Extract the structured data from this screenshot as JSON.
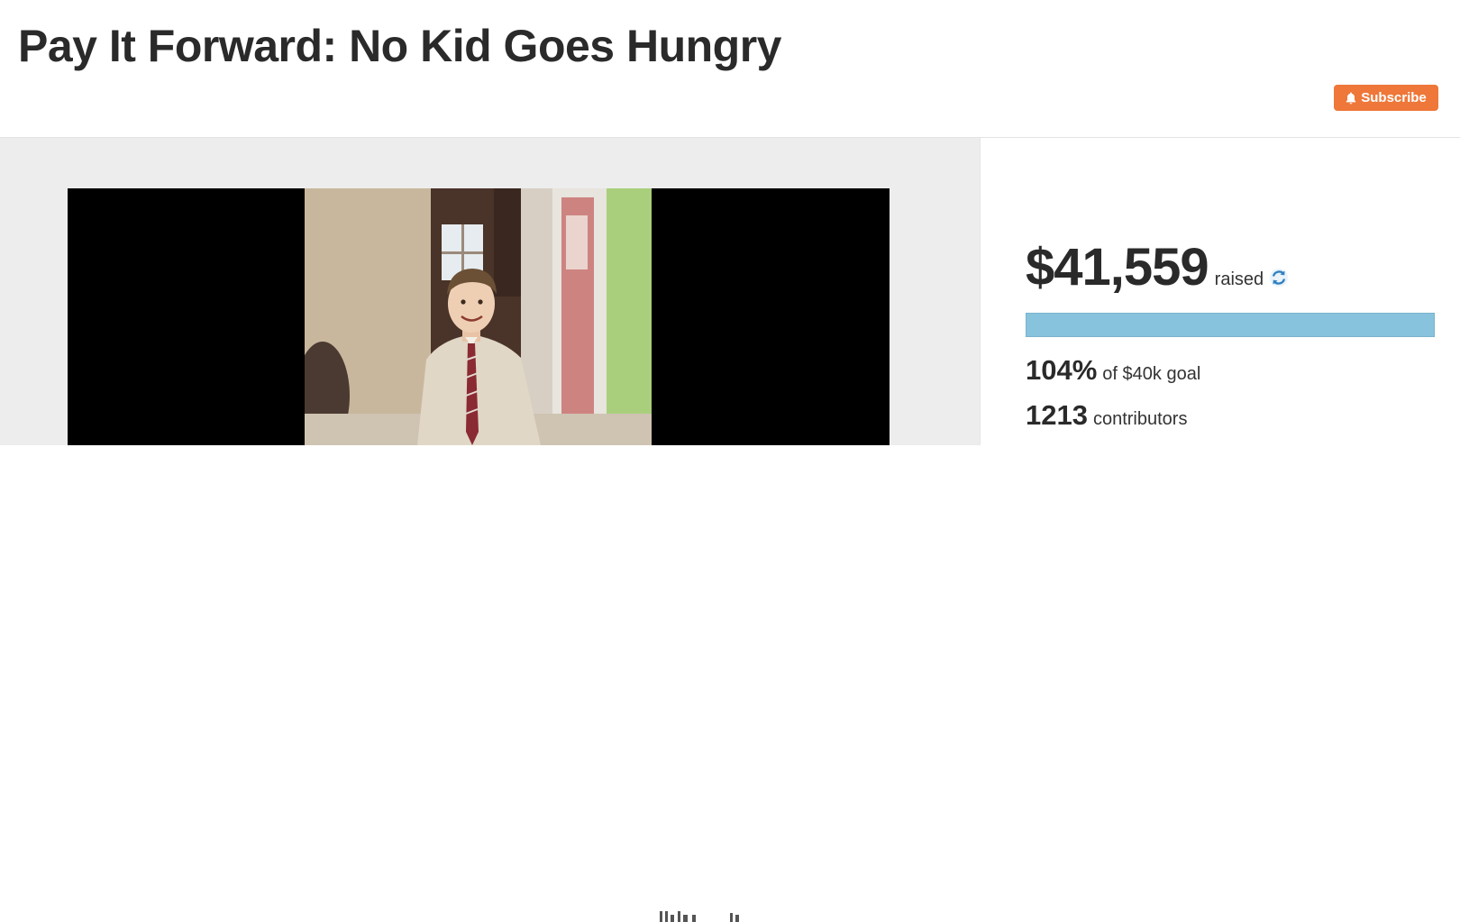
{
  "header": {
    "title": "Pay It Forward: No Kid Goes Hungry",
    "subscribe_label": "Subscribe",
    "subscribe_icon": "bell-icon",
    "accent_color": "#ee7739"
  },
  "media": {
    "type": "video",
    "image_alt": "Photo of a smiling boy wearing a dress shirt and plaid tie"
  },
  "stats": {
    "amount": "$41,559",
    "raised_label": "raised",
    "refresh_icon": "refresh-icon",
    "progress_fraction": 1.0,
    "progress_color": "#88c3de",
    "percent": "104%",
    "goal_text": "of $40k goal",
    "contributors_count": "1213",
    "contributors_label": "contributors"
  }
}
